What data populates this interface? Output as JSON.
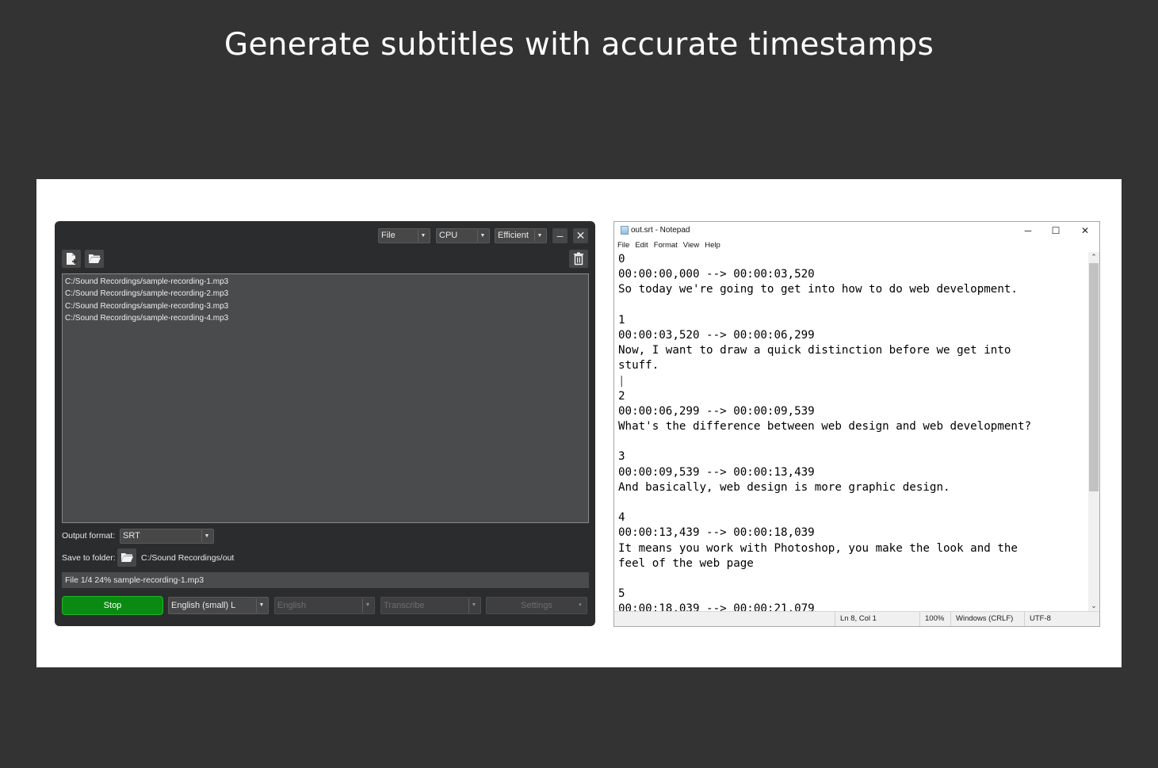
{
  "headline": "Generate subtitles with accurate timestamps",
  "app": {
    "top_dropdowns": {
      "source": "File",
      "device": "CPU",
      "quality": "Efficient"
    },
    "window_controls": {
      "minimize": "–",
      "close": "✕"
    },
    "files": [
      "C:/Sound Recordings/sample-recording-1.mp3",
      "C:/Sound Recordings/sample-recording-2.mp3",
      "C:/Sound Recordings/sample-recording-3.mp3",
      "C:/Sound Recordings/sample-recording-4.mp3"
    ],
    "output_format_label": "Output format:",
    "output_format_value": "SRT",
    "save_folder_label": "Save to folder:",
    "save_folder_value": "C:/Sound Recordings/out",
    "status_text": "File 1/4  24%  sample-recording-1.mp3",
    "bottom": {
      "stop_label": "Stop",
      "model": "English (small) L",
      "language": "English",
      "task": "Transcribe",
      "settings": "Settings"
    },
    "colors": {
      "stop_button": "#0b8a13",
      "window_bg": "#2b2c2e"
    }
  },
  "notepad": {
    "title": "out.srt - Notepad",
    "menu": [
      "File",
      "Edit",
      "Format",
      "View",
      "Help"
    ],
    "lines": [
      "0",
      "00:00:00,000 --> 00:00:03,520",
      "So today we're going to get into how to do web development.",
      "",
      "1",
      "00:00:03,520 --> 00:00:06,299",
      "Now, I want to draw a quick distinction before we get into",
      "stuff.",
      "|",
      "2",
      "00:00:06,299 --> 00:00:09,539",
      "What's the difference between web design and web development?",
      "",
      "3",
      "00:00:09,539 --> 00:00:13,439",
      "And basically, web design is more graphic design.",
      "",
      "4",
      "00:00:13,439 --> 00:00:18,039",
      "It means you work with Photoshop, you make the look and the",
      "feel of the web page",
      "",
      "5",
      "00:00:18,039 --> 00:00:21,079"
    ],
    "statusbar": {
      "position": "Ln 8, Col 1",
      "zoom": "100%",
      "line_endings": "Windows (CRLF)",
      "encoding": "UTF-8"
    }
  }
}
